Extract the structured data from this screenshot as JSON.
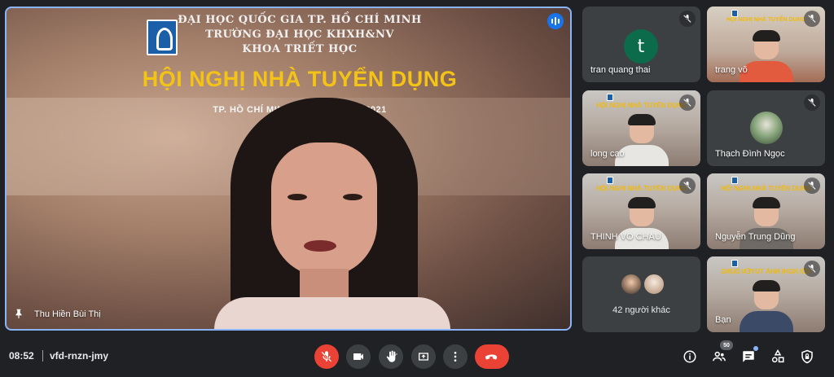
{
  "main_tile": {
    "participant_name": "Thu Hiền Bùi Thị",
    "banner": {
      "line1": "ĐẠI HỌC QUỐC GIA TP. HỒ CHÍ MINH",
      "line2": "TRƯỜNG ĐẠI HỌC KHXH&NV",
      "line3": "KHOA TRIẾT HỌC",
      "headline": "HỘI NGHỊ NHÀ TUYỂN DỤNG",
      "date": "TP. HỒ CHÍ MINH, NGÀY 12 NĂM 2021"
    }
  },
  "tiles": [
    {
      "name": "tran quang thai",
      "avatar_letter": "t"
    },
    {
      "name": "trang võ"
    },
    {
      "name": "long cao"
    },
    {
      "name": "Thạch Đình Ngọc"
    },
    {
      "name": "THINH VO CHAU"
    },
    {
      "name": "Nguyễn Trung Dũng"
    },
    {
      "name": "42 người khác"
    },
    {
      "name": "Bạn"
    }
  ],
  "slide_mini": {
    "headline": "HỘI NGHỊ NHÀ TUYỂN DỤNG"
  },
  "bottom_bar": {
    "time": "08:52",
    "meeting_code": "vfd-rnzn-jmy",
    "participant_count": "50"
  },
  "colors": {
    "accent": "#8ab4f8",
    "danger": "#ea4335",
    "speaking": "#1a73e8",
    "banner_title": "#f3c316"
  }
}
